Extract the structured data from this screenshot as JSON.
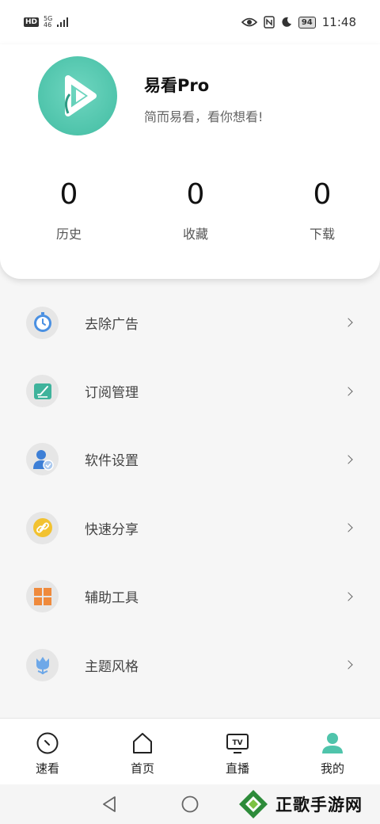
{
  "status_bar": {
    "hd": "HD",
    "net_top": "5G",
    "net_bottom": "46",
    "battery": "94",
    "time": "11:48"
  },
  "profile": {
    "app_name": "易看Pro",
    "slogan": "简而易看，看你想看!",
    "stats": [
      {
        "value": "0",
        "label": "历史"
      },
      {
        "value": "0",
        "label": "收藏"
      },
      {
        "value": "0",
        "label": "下载"
      }
    ]
  },
  "menu": {
    "items": [
      {
        "label": "去除广告",
        "icon": "stopwatch-icon"
      },
      {
        "label": "订阅管理",
        "icon": "edit-note-icon"
      },
      {
        "label": "软件设置",
        "icon": "user-settings-icon"
      },
      {
        "label": "快速分享",
        "icon": "link-icon"
      },
      {
        "label": "辅助工具",
        "icon": "grid-tools-icon"
      },
      {
        "label": "主题风格",
        "icon": "tulip-icon"
      }
    ]
  },
  "tabs": [
    {
      "label": "速看",
      "icon": "clock-icon"
    },
    {
      "label": "首页",
      "icon": "home-icon"
    },
    {
      "label": "直播",
      "icon": "tv-icon"
    },
    {
      "label": "我的",
      "icon": "person-icon"
    }
  ],
  "watermark": {
    "text": "正歌手游网"
  },
  "colors": {
    "accent": "#4fc4ab",
    "card_bg": "#ffffff",
    "page_bg": "#f6f6f6"
  }
}
